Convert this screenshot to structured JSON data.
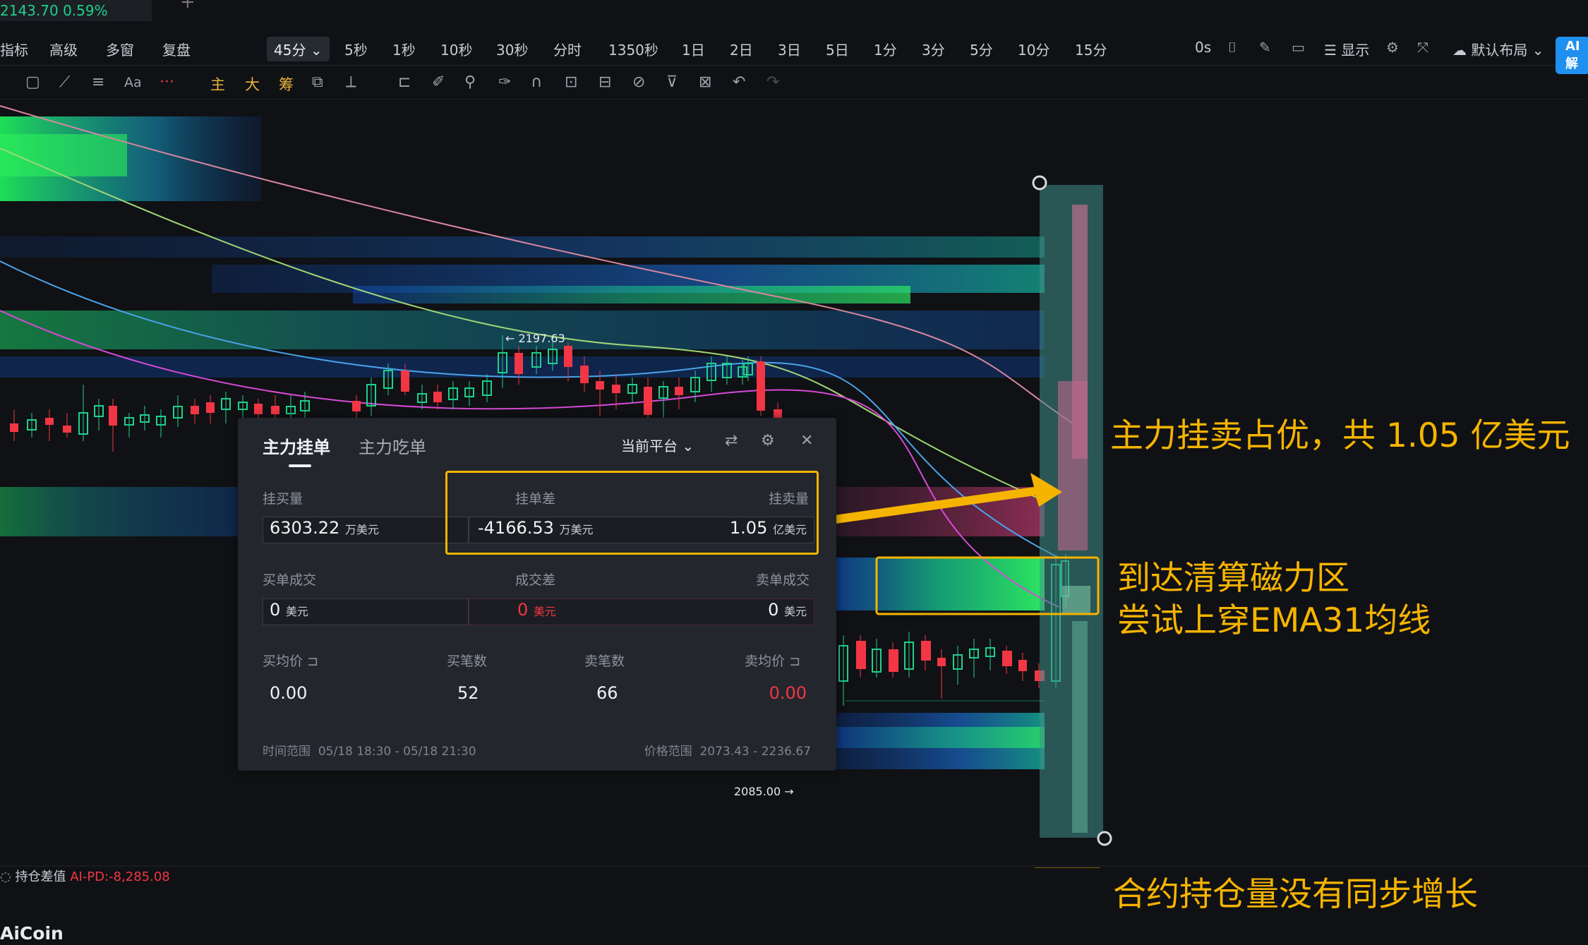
{
  "ticker": {
    "text": "2143.70  0.59%"
  },
  "toolbar1": {
    "left_items": [
      "指标",
      "高级",
      "多窗",
      "复盘"
    ],
    "selected_interval": "45分",
    "intervals": [
      "5秒",
      "1秒",
      "10秒",
      "30秒",
      "分时",
      "1350秒",
      "1日",
      "2日",
      "3日",
      "5日",
      "1分",
      "3分",
      "5分",
      "10分",
      "15分"
    ],
    "right_items": [
      "0s",
      "显示",
      "默认布局"
    ],
    "ai_button": "AI解"
  },
  "toolbar2": {
    "gold_tools": [
      "主",
      "大",
      "筹"
    ]
  },
  "chart": {
    "high_label": "← 2197.63",
    "low_label": "2085.00 →",
    "colors": {
      "up": "#1fd18b",
      "down": "#f23645",
      "annotation": "#f5b400"
    }
  },
  "panel": {
    "tabs": [
      "主力挂单",
      "主力吃单"
    ],
    "platform": "当前平台",
    "buy_orders_label": "挂买量",
    "buy_orders_value": "6303.22",
    "buy_orders_unit": "万美元",
    "order_diff_label": "挂单差",
    "order_diff_value": "-4166.53",
    "order_diff_unit": "万美元",
    "sell_orders_label": "挂卖量",
    "sell_orders_value": "1.05",
    "sell_orders_unit": "亿美元",
    "buy_fill_label": "买单成交",
    "buy_fill_value": "0",
    "buy_fill_unit": "美元",
    "fill_diff_label": "成交差",
    "fill_diff_value": "0",
    "fill_diff_unit": "美元",
    "sell_fill_label": "卖单成交",
    "sell_fill_value": "0",
    "sell_fill_unit": "美元",
    "buy_avg_label": "买均价",
    "buy_avg_value": "0.00",
    "buy_count_label": "买笔数",
    "buy_count_value": "52",
    "sell_count_label": "卖笔数",
    "sell_count_value": "66",
    "sell_avg_label": "卖均价",
    "sell_avg_value": "0.00",
    "time_range_label": "时间范围",
    "time_range_value": "05/18 18:30 - 05/18 21:30",
    "price_range_label": "价格范围",
    "price_range_value": "2073.43 - 2236.67"
  },
  "annotations": {
    "sell_dominant": "主力挂卖占优，共 1.05 亿美元",
    "liquidation_line1": "到达清算磁力区",
    "liquidation_line2": "尝试上穿EMA31均线",
    "open_interest": "合约持仓量没有同步增长"
  },
  "subpanel": {
    "title": "持仓差值",
    "value": "AI-PD:-8,285.08"
  },
  "logo": "AiCoin"
}
